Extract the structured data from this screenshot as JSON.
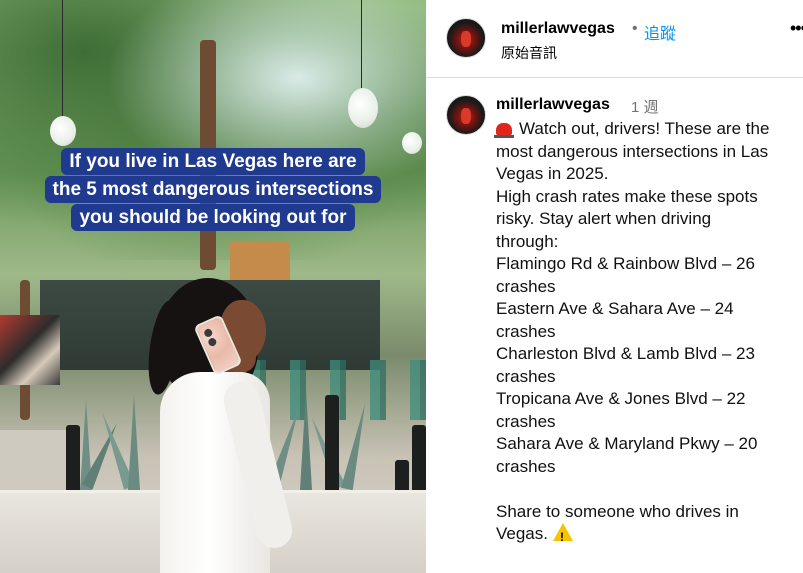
{
  "video": {
    "overlay_lines": [
      "If you live in Las Vegas here are",
      "the 5 most dangerous intersections",
      "you should be looking out for"
    ]
  },
  "header": {
    "username": "millerlawvegas",
    "separator": "•",
    "follow_label": "追蹤",
    "audio_label": "原始音訊",
    "more_icon": "more-options-icon"
  },
  "caption": {
    "username": "millerlawvegas",
    "time": "1 週",
    "lines": [
      "Watch out, drivers! These are the",
      "most dangerous intersections in Las",
      "Vegas in 2025.",
      "High crash rates make these spots",
      "risky. Stay alert when driving",
      "through:",
      "Flamingo Rd & Rainbow Blvd – 26",
      "crashes",
      "Eastern Ave & Sahara Ave – 24",
      "crashes",
      "Charleston Blvd & Lamb Blvd – 23",
      "crashes",
      "Tropicana Ave & Jones Blvd – 22",
      "crashes",
      "Sahara Ave & Maryland Pkwy – 20",
      "crashes",
      "",
      "Share to someone who drives in",
      "Vegas."
    ],
    "lead_icon": "siren-emoji-icon",
    "trail_icon": "warning-emoji-icon"
  },
  "colors": {
    "follow": "#0095f6",
    "overlay_bg": "#1f3a8f",
    "muted": "#737373"
  }
}
